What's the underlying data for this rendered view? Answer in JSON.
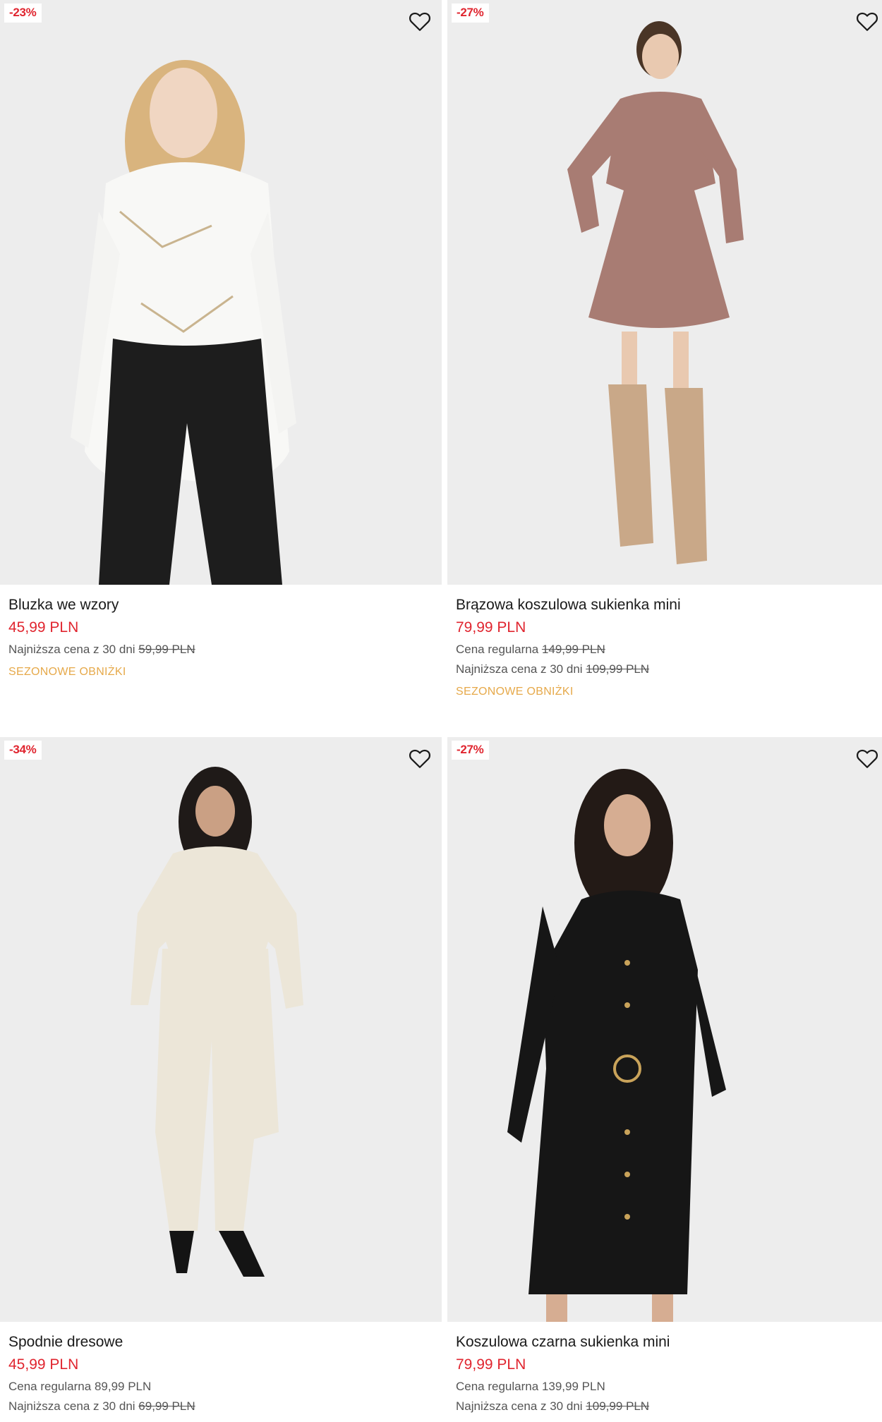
{
  "products": [
    {
      "discount": "-23%",
      "name": "Bluzka we wzory",
      "price": "45,99 PLN",
      "lowest_label": "Najniższa cena z 30 dni",
      "lowest_price": "59,99 PLN",
      "promo": "SEZONOWE OBNIŻKI"
    },
    {
      "discount": "-27%",
      "name": "Brązowa koszulowa sukienka mini",
      "price": "79,99 PLN",
      "regular_label": "Cena regularna",
      "regular_price": "149,99 PLN",
      "lowest_label": "Najniższa cena z 30 dni",
      "lowest_price": "109,99 PLN",
      "promo": "SEZONOWE OBNIŻKI"
    },
    {
      "discount": "-34%",
      "name": "Spodnie dresowe",
      "price": "45,99 PLN",
      "regular_label": "Cena regularna",
      "regular_price": "89,99 PLN",
      "lowest_label": "Najniższa cena z 30 dni",
      "lowest_price": "69,99 PLN"
    },
    {
      "discount": "-27%",
      "name": "Koszulowa czarna sukienka mini",
      "price": "79,99 PLN",
      "regular_label": "Cena regularna",
      "regular_price": "139,99 PLN",
      "lowest_label": "Najniższa cena z 30 dni",
      "lowest_price": "109,99 PLN"
    }
  ],
  "icons": {
    "favorite": "heart-outline-icon"
  },
  "colors": {
    "sale_red": "#e0252f",
    "promo_gold": "#e6a94a",
    "text": "#1a1a1a",
    "muted": "#555555"
  }
}
